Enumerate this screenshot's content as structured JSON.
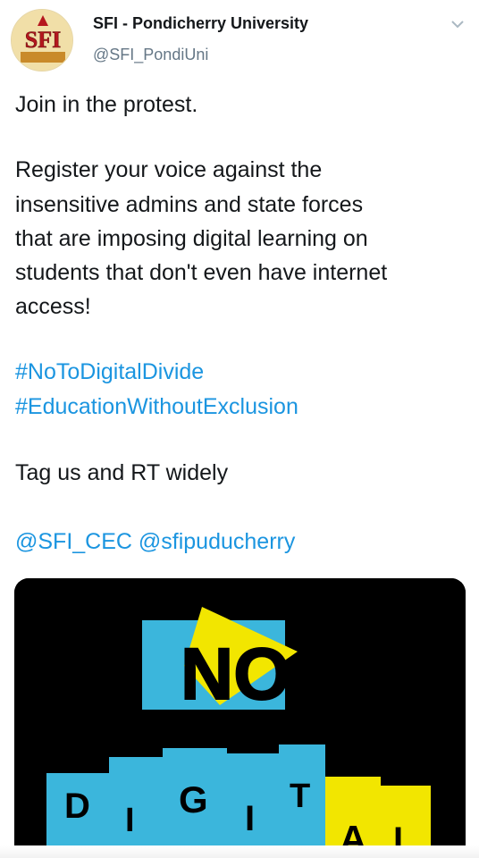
{
  "tweet": {
    "author_name": "SFI - Pondicherry University",
    "author_handle": "@SFI_PondiUni",
    "avatar_text": "SFI",
    "line_1": "Join in the protest.",
    "para_lines": [
      "Register your voice against the",
      "insensitive admins and state forces",
      "that are imposing digital learning on",
      "students that don't even have internet",
      "access!"
    ],
    "hashtags": [
      "#NoToDigitalDivide",
      "#EducationWithoutExclusion"
    ],
    "tag_line": "Tag us and RT widely",
    "mentions": "@SFI_CEC @sfipuducherry"
  },
  "media": {
    "word_no": "NO",
    "letters": [
      "D",
      "I",
      "G",
      "I",
      "T",
      "A",
      "L"
    ],
    "colors": {
      "cyan": "#3bb6dc",
      "yellow": "#f2e600",
      "black": "#000000"
    }
  },
  "colors": {
    "link": "#1b95e0",
    "handle": "#657786"
  }
}
